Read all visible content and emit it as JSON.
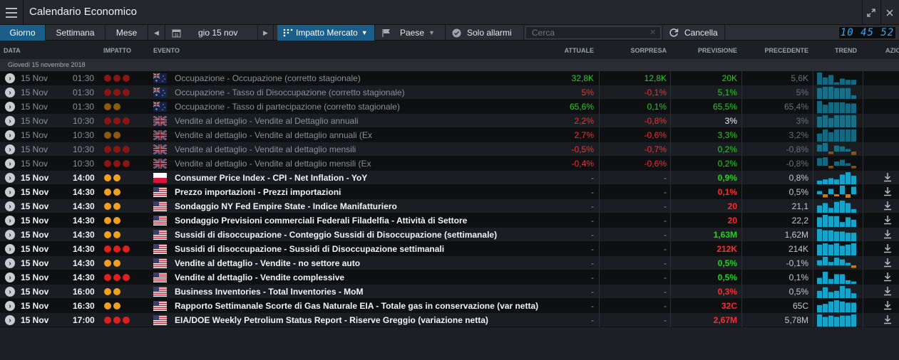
{
  "window": {
    "title": "Calendario Economico"
  },
  "toolbar": {
    "tab_day": "Giorno",
    "tab_week": "Settimana",
    "tab_month": "Mese",
    "date": "gio 15 nov",
    "impact_filter": "Impatto Mercato",
    "country_filter": "Paese",
    "alarms": "Solo allarmi",
    "search_placeholder": "Cerca",
    "clear": "Cancella",
    "clock": "10 45 52"
  },
  "columns": {
    "date": "DATA",
    "impact": "IMPATTO",
    "event": "EVENTO",
    "actual": "ATTUALE",
    "surprise": "SORPRESA",
    "forecast": "PREVISIONE",
    "previous": "PRECEDENTE",
    "trend": "TREND",
    "actions": "AZIO"
  },
  "group_label": "Giovedì 15 novembre 2018",
  "colors": {
    "positive": "#23d11e",
    "negative": "#ff2b2b",
    "accent": "#1b5e8a",
    "trend_bar": "#1aa3c8",
    "trend_neg": "#c97a1a"
  },
  "rows": [
    {
      "date": "15 Nov",
      "time": "01:30",
      "impact": 3,
      "flag": "AU",
      "event": "Occupazione - Occupazione (corretto stagionale)",
      "actual": "32,8K",
      "actual_c": "pos",
      "surprise": "12,8K",
      "surprise_c": "pos",
      "forecast": "20K",
      "forecast_c": "pos",
      "previous": "5,6K",
      "past": true,
      "trend": [
        10,
        6,
        8,
        2,
        5,
        4,
        4
      ]
    },
    {
      "date": "15 Nov",
      "time": "01:30",
      "impact": 3,
      "flag": "AU",
      "event": "Occupazione - Tasso di Disoccupazione (corretto stagionale)",
      "actual": "5%",
      "actual_c": "neg",
      "surprise": "-0,1%",
      "surprise_c": "neg",
      "forecast": "5,1%",
      "forecast_c": "pos",
      "previous": "5%",
      "past": true,
      "trend": [
        9,
        10,
        10,
        9,
        9,
        9,
        3
      ]
    },
    {
      "date": "15 Nov",
      "time": "01:30",
      "impact": 2,
      "flag": "AU",
      "event": "Occupazione - Tasso di partecipazione (corretto stagionale)",
      "actual": "65,6%",
      "actual_c": "pos",
      "surprise": "0,1%",
      "surprise_c": "pos",
      "forecast": "65,5%",
      "forecast_c": "pos",
      "previous": "65,4%",
      "past": true,
      "trend": [
        10,
        7,
        9,
        9,
        9,
        8,
        8
      ]
    },
    {
      "date": "15 Nov",
      "time": "10:30",
      "impact": 3,
      "flag": "GB",
      "event": "Vendite al dettaglio - Vendite al Dettaglio annuali",
      "actual": "2,2%",
      "actual_c": "neg",
      "surprise": "-0,8%",
      "surprise_c": "neg",
      "forecast": "3%",
      "forecast_c": "white",
      "previous": "3%",
      "past": true,
      "trend": [
        8,
        9,
        7,
        9,
        9,
        9,
        9
      ]
    },
    {
      "date": "15 Nov",
      "time": "10:30",
      "impact": 2,
      "flag": "GB",
      "event": "Vendite al dettaglio - Vendite al dettaglio annuali (Ex",
      "actual": "2,7%",
      "actual_c": "neg",
      "surprise": "-0,6%",
      "surprise_c": "neg",
      "forecast": "3,3%",
      "forecast_c": "pos",
      "previous": "3,2%",
      "past": true,
      "trend": [
        6,
        9,
        7,
        9,
        9,
        9,
        9
      ]
    },
    {
      "date": "15 Nov",
      "time": "10:30",
      "impact": 3,
      "flag": "GB",
      "event": "Vendite al dettaglio - Vendite al dettaglio mensili",
      "actual": "-0,5%",
      "actual_c": "neg",
      "surprise": "-0,7%",
      "surprise_c": "neg",
      "forecast": "0,2%",
      "forecast_c": "pos",
      "previous": "-0,8%",
      "past": true,
      "trend": [
        8,
        10,
        -3,
        7,
        6,
        3,
        -4
      ]
    },
    {
      "date": "15 Nov",
      "time": "10:30",
      "impact": 3,
      "flag": "GB",
      "event": "Vendite al dettaglio - Vendite al dettaglio mensili (Ex",
      "actual": "-0,4%",
      "actual_c": "neg",
      "surprise": "-0,6%",
      "surprise_c": "neg",
      "forecast": "0,2%",
      "forecast_c": "pos",
      "previous": "-0,8%",
      "past": true,
      "trend": [
        9,
        10,
        -3,
        5,
        7,
        3,
        -3
      ]
    },
    {
      "date": "15 Nov",
      "time": "14:00",
      "impact": 2,
      "flag": "PL",
      "event": "Consumer Price Index - CPI - Net Inflation - YoY",
      "actual": "-",
      "actual_c": "dim",
      "surprise": "-",
      "surprise_c": "dim",
      "forecast": "0,9%",
      "forecast_c": "pos",
      "previous": "0,8%",
      "past": false,
      "trend": [
        3,
        4,
        5,
        4,
        8,
        10,
        7
      ]
    },
    {
      "date": "15 Nov",
      "time": "14:30",
      "impact": 2,
      "flag": "US",
      "event": "Prezzo importazioni - Prezzi importazioni",
      "actual": "-",
      "actual_c": "dim",
      "surprise": "-",
      "surprise_c": "dim",
      "forecast": "0,1%",
      "forecast_c": "neg",
      "previous": "0,5%",
      "past": false,
      "trend": [
        3,
        -3,
        5,
        -2,
        8,
        -4,
        7
      ]
    },
    {
      "date": "15 Nov",
      "time": "14:30",
      "impact": 2,
      "flag": "US",
      "event": "Sondaggio NY Fed Empire State - Indice Manifatturiero",
      "actual": "-",
      "actual_c": "dim",
      "surprise": "-",
      "surprise_c": "dim",
      "forecast": "20",
      "forecast_c": "neg",
      "previous": "21,1",
      "past": false,
      "trend": [
        6,
        8,
        4,
        9,
        10,
        8,
        3
      ]
    },
    {
      "date": "15 Nov",
      "time": "14:30",
      "impact": 2,
      "flag": "US",
      "event": "Sondaggio Previsioni commerciali Federali Filadelfia - Attività di Settore",
      "actual": "-",
      "actual_c": "dim",
      "surprise": "-",
      "surprise_c": "dim",
      "forecast": "20",
      "forecast_c": "neg",
      "previous": "22,2",
      "past": false,
      "trend": [
        8,
        10,
        9,
        9,
        4,
        8,
        6
      ]
    },
    {
      "date": "15 Nov",
      "time": "14:30",
      "impact": 2,
      "flag": "US",
      "event": "Sussidi di disoccupazione - Conteggio Sussidi di Disoccupazione (settimanale)",
      "actual": "-",
      "actual_c": "dim",
      "surprise": "-",
      "surprise_c": "dim",
      "forecast": "1,63M",
      "forecast_c": "pos",
      "previous": "1,62M",
      "past": false,
      "trend": [
        10,
        9,
        9,
        8,
        8,
        7,
        7
      ]
    },
    {
      "date": "15 Nov",
      "time": "14:30",
      "impact": 3,
      "flag": "US",
      "event": "Sussidi di disoccupazione - Sussidi di Disoccupazione settimanali",
      "actual": "-",
      "actual_c": "dim",
      "surprise": "-",
      "surprise_c": "dim",
      "forecast": "212K",
      "forecast_c": "neg",
      "previous": "214K",
      "past": false,
      "trend": [
        9,
        10,
        9,
        10,
        8,
        9,
        10
      ]
    },
    {
      "date": "15 Nov",
      "time": "14:30",
      "impact": 2,
      "flag": "US",
      "event": "Vendite al dettaglio - Vendite - no settore auto",
      "actual": "-",
      "actual_c": "dim",
      "surprise": "-",
      "surprise_c": "dim",
      "forecast": "0,5%",
      "forecast_c": "pos",
      "previous": "-0,1%",
      "past": false,
      "trend": [
        6,
        10,
        4,
        9,
        7,
        3,
        -3
      ]
    },
    {
      "date": "15 Nov",
      "time": "14:30",
      "impact": 3,
      "flag": "US",
      "event": "Vendite al dettaglio - Vendite complessive",
      "actual": "-",
      "actual_c": "dim",
      "surprise": "-",
      "surprise_c": "dim",
      "forecast": "0,5%",
      "forecast_c": "pos",
      "previous": "0,1%",
      "past": false,
      "trend": [
        5,
        10,
        4,
        8,
        8,
        3,
        2
      ]
    },
    {
      "date": "15 Nov",
      "time": "16:00",
      "impact": 2,
      "flag": "US",
      "event": "Business Inventories - Total Inventories - MoM",
      "actual": "-",
      "actual_c": "dim",
      "surprise": "-",
      "surprise_c": "dim",
      "forecast": "0,3%",
      "forecast_c": "neg",
      "previous": "0,5%",
      "past": false,
      "trend": [
        6,
        9,
        5,
        6,
        10,
        8,
        4
      ]
    },
    {
      "date": "15 Nov",
      "time": "16:30",
      "impact": 2,
      "flag": "US",
      "event": "Rapporto Settimanale Scorte di Gas Naturale EIA - Totale gas in conservazione (var netta)",
      "actual": "-",
      "actual_c": "dim",
      "surprise": "-",
      "surprise_c": "dim",
      "forecast": "32C",
      "forecast_c": "neg",
      "previous": "65C",
      "past": false,
      "trend": [
        6,
        7,
        9,
        10,
        9,
        8,
        8
      ]
    },
    {
      "date": "15 Nov",
      "time": "17:00",
      "impact": 3,
      "flag": "US",
      "event": "EIA/DOE Weekly Petrolium Status Report - Riserve Greggio (variazione netta)",
      "actual": "-",
      "actual_c": "dim",
      "surprise": "-",
      "surprise_c": "dim",
      "forecast": "2,67M",
      "forecast_c": "neg",
      "previous": "5,78M",
      "past": false,
      "trend": [
        10,
        8,
        9,
        8,
        9,
        9,
        10
      ]
    }
  ]
}
